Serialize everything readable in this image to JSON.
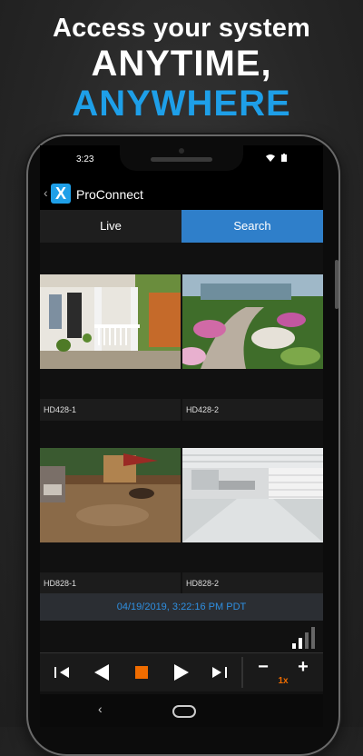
{
  "promo": {
    "line1": "Access your system",
    "line2": "ANYTIME,",
    "line3": "ANYWHERE"
  },
  "status_bar": {
    "time": "3:23"
  },
  "app": {
    "title": "ProConnect",
    "logo_letter": "X"
  },
  "tabs": [
    {
      "label": "Live",
      "active": false
    },
    {
      "label": "Search",
      "active": true
    }
  ],
  "cameras": [
    {
      "name": "HD428-1",
      "scene": "porch"
    },
    {
      "name": "HD428-2",
      "scene": "garden"
    },
    {
      "name": "HD828-1",
      "scene": "patio"
    },
    {
      "name": "HD828-2",
      "scene": "garage"
    }
  ],
  "playback": {
    "timestamp": "04/19/2019, 3:22:16 PM PDT",
    "speed": "1x"
  },
  "icons": {
    "step_back": "step-back-icon",
    "reverse": "reverse-icon",
    "stop": "stop-icon",
    "play": "play-icon",
    "step_forward": "step-forward-icon",
    "zoom_out": "minus-icon",
    "zoom_in": "plus-icon",
    "signal": "signal-strength-icon"
  },
  "colors": {
    "accent": "#1e9fe8",
    "tab_active": "#2f7fca",
    "stop": "#ef6c00",
    "timestamp": "#2f8fe0"
  }
}
